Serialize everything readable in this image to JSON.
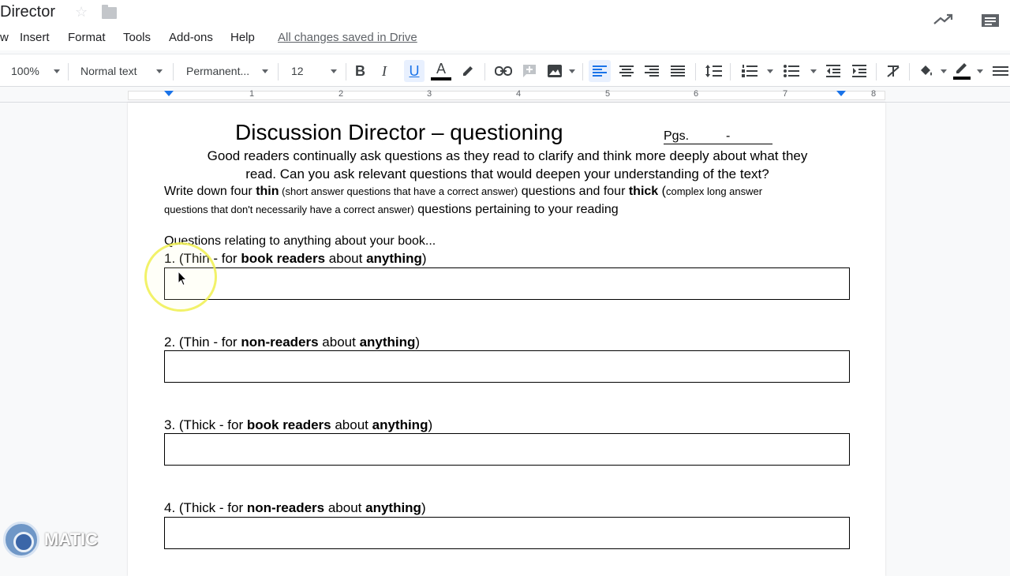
{
  "title_bar": {
    "doc_title": "Director"
  },
  "menu": {
    "items": [
      "w",
      "Insert",
      "Format",
      "Tools",
      "Add-ons",
      "Help"
    ],
    "status": "All changes saved in Drive"
  },
  "toolbar": {
    "zoom": "100%",
    "style": "Normal text",
    "font": "Permanent...",
    "font_size": "12",
    "bold": "B",
    "italic": "I",
    "underline": "U",
    "text_color": "A",
    "underline_active": true
  },
  "ruler": {
    "numbers": [
      "1",
      "2",
      "3",
      "4",
      "5",
      "6",
      "7",
      "8"
    ]
  },
  "document": {
    "heading": "Discussion Director – questioning",
    "pgs_label": "Pgs.",
    "pgs_dash": "-",
    "intro_line1": "Good readers continually ask questions as they read to clarify and think more deeply about what they",
    "intro_line2": "read.  Can you ask relevant questions that would deepen your understanding of the text?",
    "instr": {
      "p1": "Write down four ",
      "thin": "thin",
      "p2": " (short answer questions that have a correct answer)",
      "p3": " questions and four ",
      "thick": "thick",
      "p4": " (",
      "p5": "complex long answer",
      "p6": "questions that don't necessarily have a correct answer)",
      "p7": " questions pertaining to your reading"
    },
    "section_label": "Questions relating to anything about your book...",
    "questions": [
      {
        "prefix": "1. (Thin - for ",
        "bold1": "book readers",
        "mid": " about ",
        "bold2": "anything",
        "suffix": ")"
      },
      {
        "prefix": "2. (Thin - for ",
        "bold1": "non-readers",
        "mid": " about ",
        "bold2": "anything",
        "suffix": ")"
      },
      {
        "prefix": "3. (Thick - for ",
        "bold1": "book readers",
        "mid": " about ",
        "bold2": "anything",
        "suffix": ")"
      },
      {
        "prefix": "4. (Thick - for ",
        "bold1": "non-readers",
        "mid": " about ",
        "bold2": "anything",
        "suffix": ")"
      }
    ]
  },
  "watermark": {
    "text": "MATIC"
  },
  "colors": {
    "accent": "#1a73e8",
    "highlight_ring": "#f0f050"
  }
}
